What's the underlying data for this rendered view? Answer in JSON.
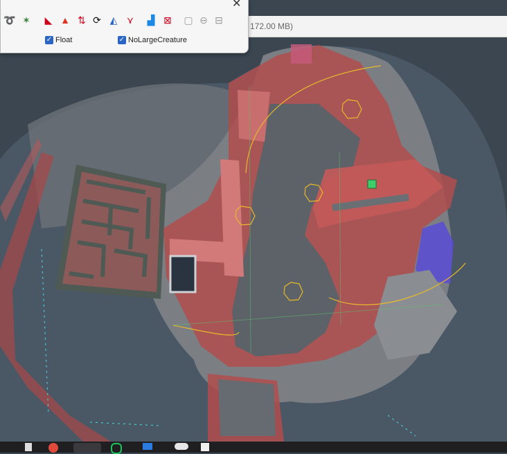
{
  "window": {
    "memory_label": "172.00 MB)"
  },
  "toolbar": {
    "tools": [
      {
        "icon": "lasso-tool-icon",
        "glyph": "➰",
        "color": "#b22222"
      },
      {
        "icon": "palm-tree-icon",
        "glyph": "✶",
        "color": "#2e7d32"
      },
      {
        "icon": "red-flag-icon",
        "glyph": "◣",
        "color": "#d0021b"
      },
      {
        "icon": "terrain-triangle-icon",
        "glyph": "▲",
        "color": "#e0331f"
      },
      {
        "icon": "sort-arrows-icon",
        "glyph": "⇅",
        "color": "#d0021b"
      },
      {
        "icon": "rotate-icon",
        "glyph": "⟳",
        "color": "#111111"
      },
      {
        "icon": "pyramid-icon",
        "glyph": "◭",
        "color": "#2b66c6"
      },
      {
        "icon": "node-graph-icon",
        "glyph": "⋎",
        "color": "#d0021b"
      },
      {
        "icon": "water-level-icon",
        "glyph": "▟",
        "color": "#1e88e5"
      },
      {
        "icon": "invalid-mesh-icon",
        "glyph": "⊠",
        "color": "#d0021b"
      },
      {
        "icon": "cube-icon",
        "glyph": "▢",
        "color": "#9a9a9a"
      },
      {
        "icon": "minus-circle-icon",
        "glyph": "⊖",
        "color": "#9a9a9a"
      },
      {
        "icon": "minus-square-icon",
        "glyph": "⊟",
        "color": "#9a9a9a"
      }
    ],
    "checkboxes": [
      {
        "label": "Float",
        "checked": true
      },
      {
        "label": "NoLargeCreature",
        "checked": true
      }
    ]
  },
  "taskbar": {
    "icons": [
      "file-icon",
      "chrome-icon",
      "app-icon",
      "spotify-icon",
      "folder-icon",
      "cloud-icon",
      "notes-icon"
    ]
  }
}
